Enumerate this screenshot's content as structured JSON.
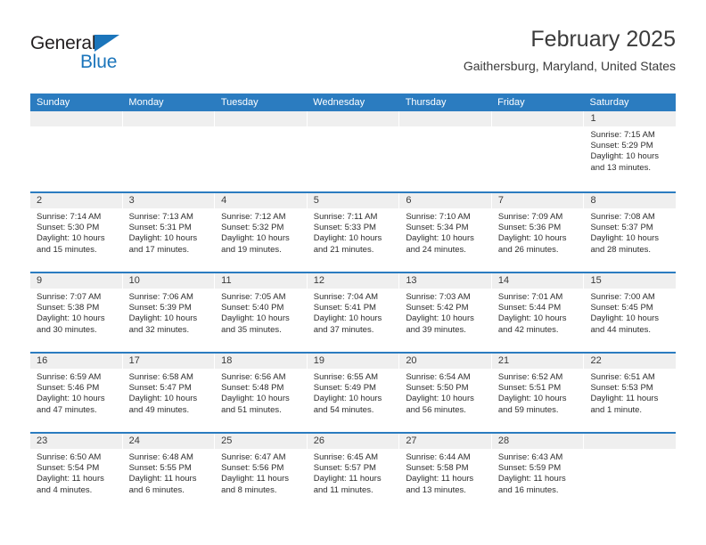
{
  "brand": {
    "name_part1": "General",
    "name_part2": "Blue",
    "accent_color": "#1b75bb"
  },
  "header": {
    "month_title": "February 2025",
    "location": "Gaithersburg, Maryland, United States"
  },
  "theme": {
    "header_bar_color": "#2b7cc0",
    "day_band_color": "#efefef",
    "text_color": "#2d2d2d"
  },
  "calendar": {
    "weekday_headers": [
      "Sunday",
      "Monday",
      "Tuesday",
      "Wednesday",
      "Thursday",
      "Friday",
      "Saturday"
    ],
    "weeks": [
      [
        {
          "day": "",
          "sunrise": "",
          "sunset": "",
          "daylight1": "",
          "daylight2": ""
        },
        {
          "day": "",
          "sunrise": "",
          "sunset": "",
          "daylight1": "",
          "daylight2": ""
        },
        {
          "day": "",
          "sunrise": "",
          "sunset": "",
          "daylight1": "",
          "daylight2": ""
        },
        {
          "day": "",
          "sunrise": "",
          "sunset": "",
          "daylight1": "",
          "daylight2": ""
        },
        {
          "day": "",
          "sunrise": "",
          "sunset": "",
          "daylight1": "",
          "daylight2": ""
        },
        {
          "day": "",
          "sunrise": "",
          "sunset": "",
          "daylight1": "",
          "daylight2": ""
        },
        {
          "day": "1",
          "sunrise": "Sunrise: 7:15 AM",
          "sunset": "Sunset: 5:29 PM",
          "daylight1": "Daylight: 10 hours",
          "daylight2": "and 13 minutes."
        }
      ],
      [
        {
          "day": "2",
          "sunrise": "Sunrise: 7:14 AM",
          "sunset": "Sunset: 5:30 PM",
          "daylight1": "Daylight: 10 hours",
          "daylight2": "and 15 minutes."
        },
        {
          "day": "3",
          "sunrise": "Sunrise: 7:13 AM",
          "sunset": "Sunset: 5:31 PM",
          "daylight1": "Daylight: 10 hours",
          "daylight2": "and 17 minutes."
        },
        {
          "day": "4",
          "sunrise": "Sunrise: 7:12 AM",
          "sunset": "Sunset: 5:32 PM",
          "daylight1": "Daylight: 10 hours",
          "daylight2": "and 19 minutes."
        },
        {
          "day": "5",
          "sunrise": "Sunrise: 7:11 AM",
          "sunset": "Sunset: 5:33 PM",
          "daylight1": "Daylight: 10 hours",
          "daylight2": "and 21 minutes."
        },
        {
          "day": "6",
          "sunrise": "Sunrise: 7:10 AM",
          "sunset": "Sunset: 5:34 PM",
          "daylight1": "Daylight: 10 hours",
          "daylight2": "and 24 minutes."
        },
        {
          "day": "7",
          "sunrise": "Sunrise: 7:09 AM",
          "sunset": "Sunset: 5:36 PM",
          "daylight1": "Daylight: 10 hours",
          "daylight2": "and 26 minutes."
        },
        {
          "day": "8",
          "sunrise": "Sunrise: 7:08 AM",
          "sunset": "Sunset: 5:37 PM",
          "daylight1": "Daylight: 10 hours",
          "daylight2": "and 28 minutes."
        }
      ],
      [
        {
          "day": "9",
          "sunrise": "Sunrise: 7:07 AM",
          "sunset": "Sunset: 5:38 PM",
          "daylight1": "Daylight: 10 hours",
          "daylight2": "and 30 minutes."
        },
        {
          "day": "10",
          "sunrise": "Sunrise: 7:06 AM",
          "sunset": "Sunset: 5:39 PM",
          "daylight1": "Daylight: 10 hours",
          "daylight2": "and 32 minutes."
        },
        {
          "day": "11",
          "sunrise": "Sunrise: 7:05 AM",
          "sunset": "Sunset: 5:40 PM",
          "daylight1": "Daylight: 10 hours",
          "daylight2": "and 35 minutes."
        },
        {
          "day": "12",
          "sunrise": "Sunrise: 7:04 AM",
          "sunset": "Sunset: 5:41 PM",
          "daylight1": "Daylight: 10 hours",
          "daylight2": "and 37 minutes."
        },
        {
          "day": "13",
          "sunrise": "Sunrise: 7:03 AM",
          "sunset": "Sunset: 5:42 PM",
          "daylight1": "Daylight: 10 hours",
          "daylight2": "and 39 minutes."
        },
        {
          "day": "14",
          "sunrise": "Sunrise: 7:01 AM",
          "sunset": "Sunset: 5:44 PM",
          "daylight1": "Daylight: 10 hours",
          "daylight2": "and 42 minutes."
        },
        {
          "day": "15",
          "sunrise": "Sunrise: 7:00 AM",
          "sunset": "Sunset: 5:45 PM",
          "daylight1": "Daylight: 10 hours",
          "daylight2": "and 44 minutes."
        }
      ],
      [
        {
          "day": "16",
          "sunrise": "Sunrise: 6:59 AM",
          "sunset": "Sunset: 5:46 PM",
          "daylight1": "Daylight: 10 hours",
          "daylight2": "and 47 minutes."
        },
        {
          "day": "17",
          "sunrise": "Sunrise: 6:58 AM",
          "sunset": "Sunset: 5:47 PM",
          "daylight1": "Daylight: 10 hours",
          "daylight2": "and 49 minutes."
        },
        {
          "day": "18",
          "sunrise": "Sunrise: 6:56 AM",
          "sunset": "Sunset: 5:48 PM",
          "daylight1": "Daylight: 10 hours",
          "daylight2": "and 51 minutes."
        },
        {
          "day": "19",
          "sunrise": "Sunrise: 6:55 AM",
          "sunset": "Sunset: 5:49 PM",
          "daylight1": "Daylight: 10 hours",
          "daylight2": "and 54 minutes."
        },
        {
          "day": "20",
          "sunrise": "Sunrise: 6:54 AM",
          "sunset": "Sunset: 5:50 PM",
          "daylight1": "Daylight: 10 hours",
          "daylight2": "and 56 minutes."
        },
        {
          "day": "21",
          "sunrise": "Sunrise: 6:52 AM",
          "sunset": "Sunset: 5:51 PM",
          "daylight1": "Daylight: 10 hours",
          "daylight2": "and 59 minutes."
        },
        {
          "day": "22",
          "sunrise": "Sunrise: 6:51 AM",
          "sunset": "Sunset: 5:53 PM",
          "daylight1": "Daylight: 11 hours",
          "daylight2": "and 1 minute."
        }
      ],
      [
        {
          "day": "23",
          "sunrise": "Sunrise: 6:50 AM",
          "sunset": "Sunset: 5:54 PM",
          "daylight1": "Daylight: 11 hours",
          "daylight2": "and 4 minutes."
        },
        {
          "day": "24",
          "sunrise": "Sunrise: 6:48 AM",
          "sunset": "Sunset: 5:55 PM",
          "daylight1": "Daylight: 11 hours",
          "daylight2": "and 6 minutes."
        },
        {
          "day": "25",
          "sunrise": "Sunrise: 6:47 AM",
          "sunset": "Sunset: 5:56 PM",
          "daylight1": "Daylight: 11 hours",
          "daylight2": "and 8 minutes."
        },
        {
          "day": "26",
          "sunrise": "Sunrise: 6:45 AM",
          "sunset": "Sunset: 5:57 PM",
          "daylight1": "Daylight: 11 hours",
          "daylight2": "and 11 minutes."
        },
        {
          "day": "27",
          "sunrise": "Sunrise: 6:44 AM",
          "sunset": "Sunset: 5:58 PM",
          "daylight1": "Daylight: 11 hours",
          "daylight2": "and 13 minutes."
        },
        {
          "day": "28",
          "sunrise": "Sunrise: 6:43 AM",
          "sunset": "Sunset: 5:59 PM",
          "daylight1": "Daylight: 11 hours",
          "daylight2": "and 16 minutes."
        },
        {
          "day": "",
          "sunrise": "",
          "sunset": "",
          "daylight1": "",
          "daylight2": ""
        }
      ]
    ]
  }
}
